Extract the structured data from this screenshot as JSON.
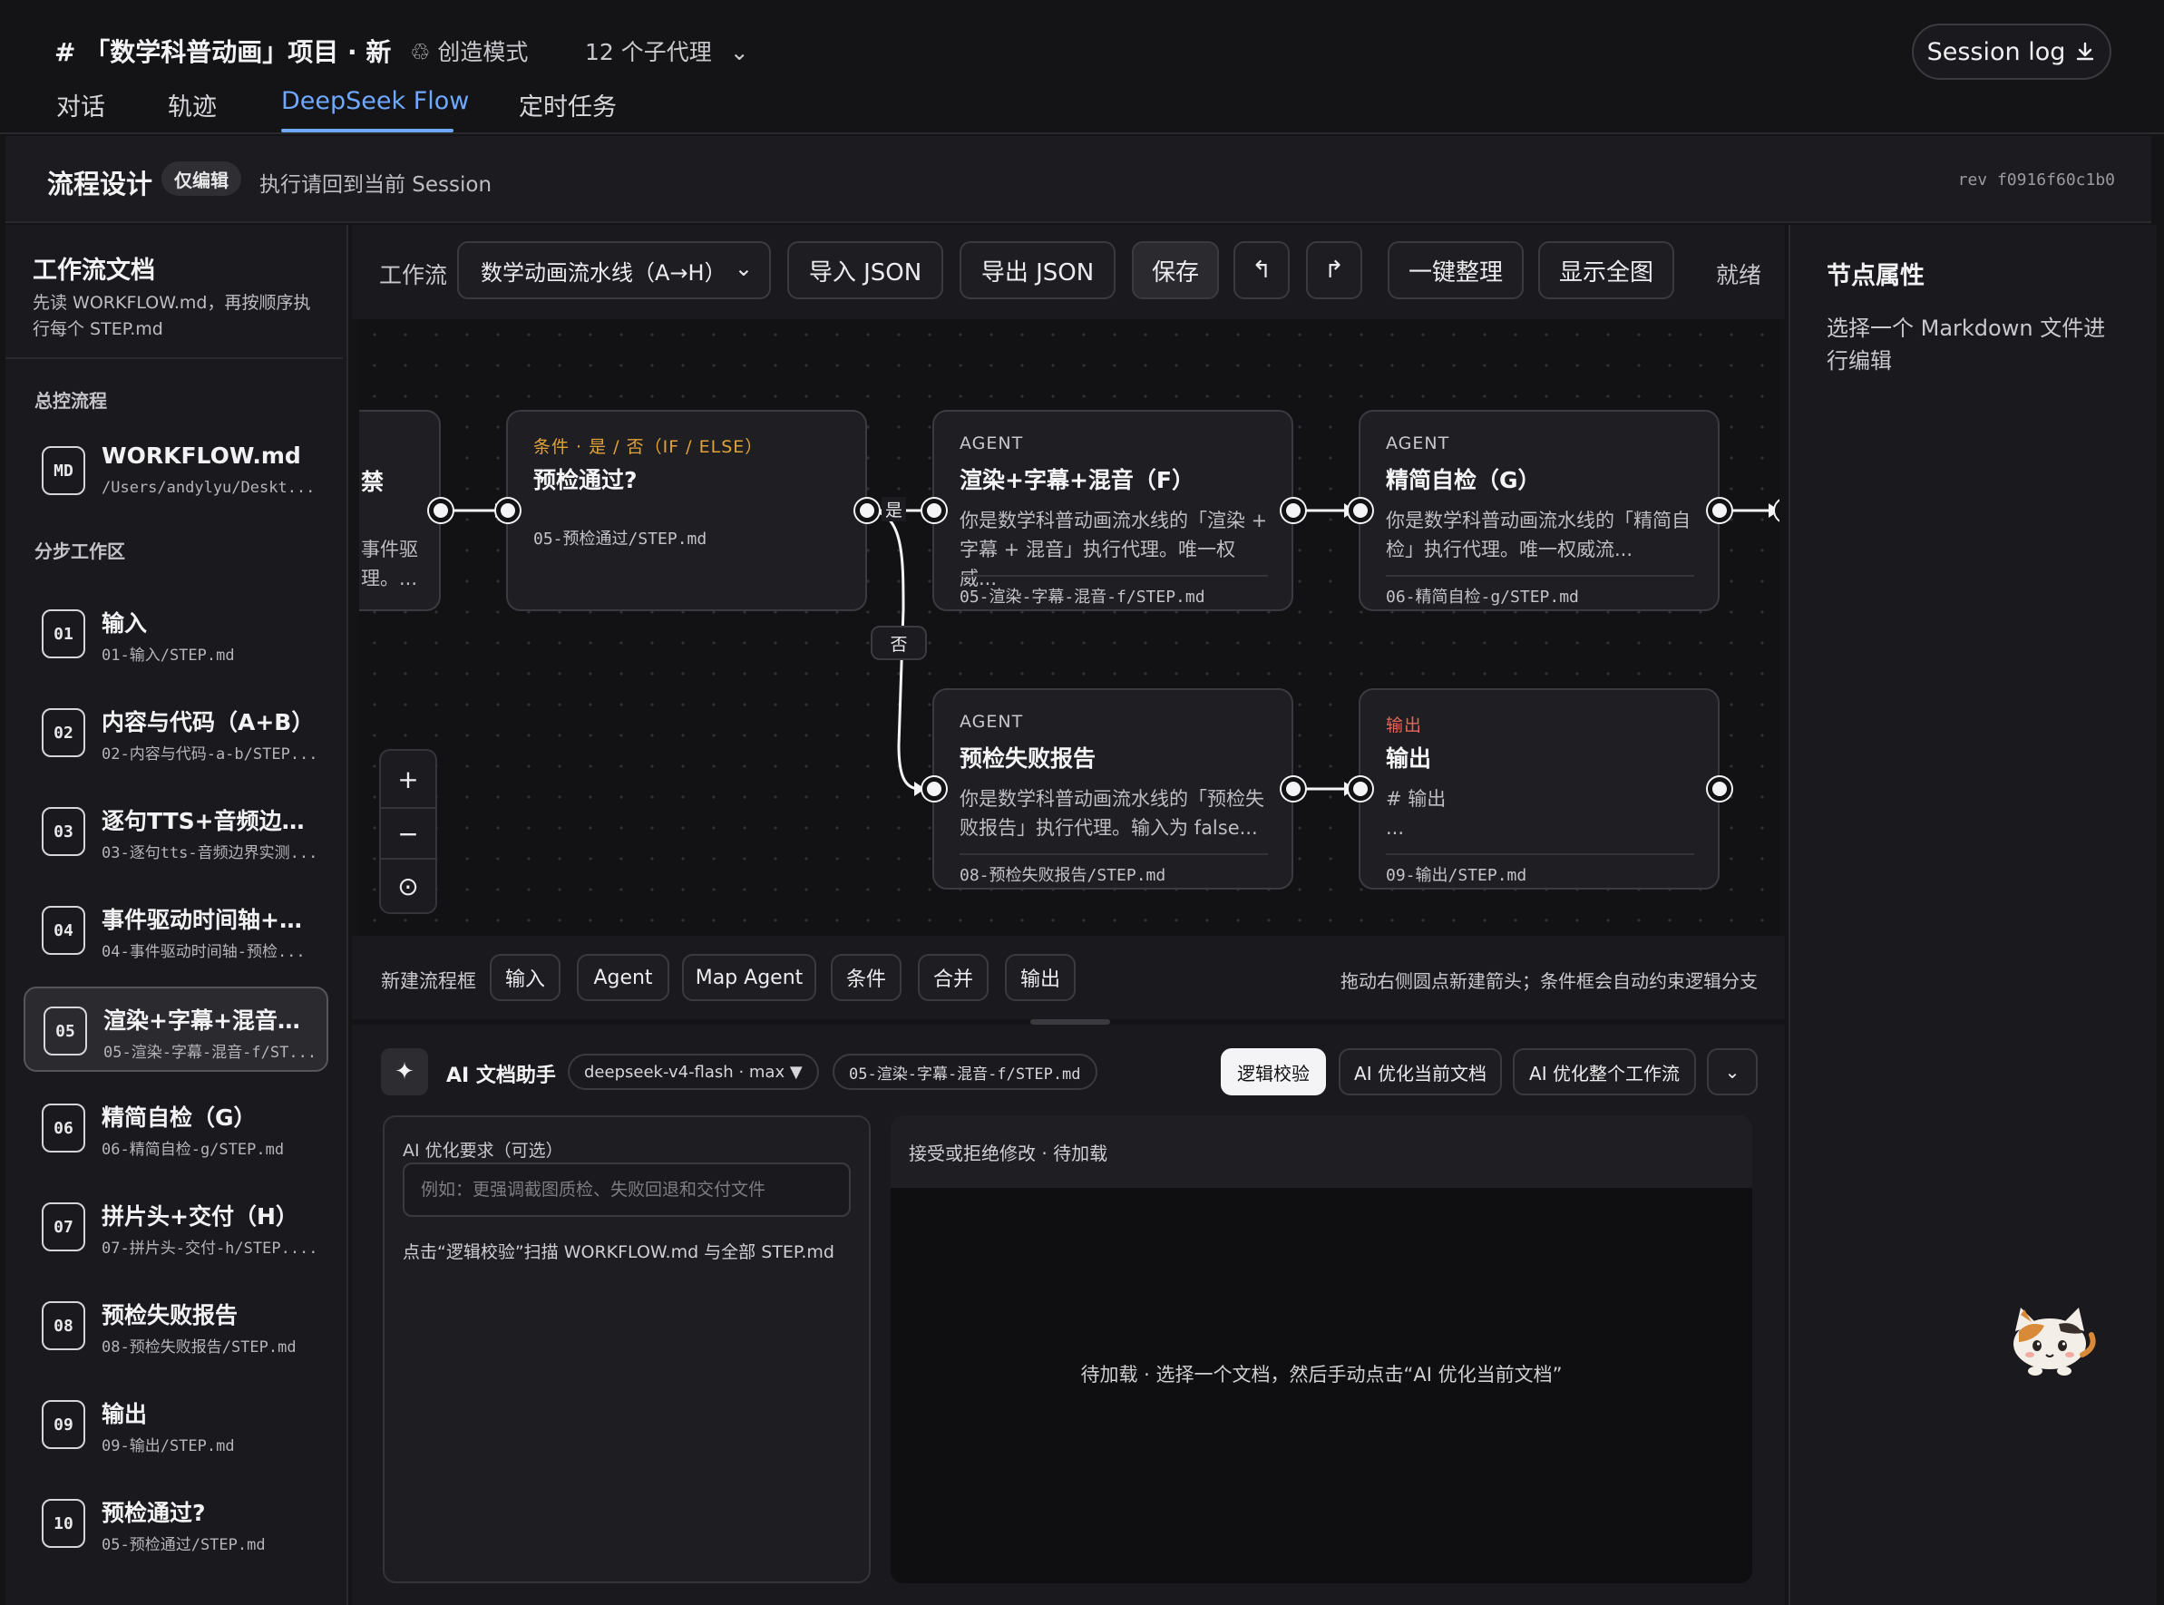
{
  "header": {
    "project_title": "# 「数学科普动画」项目 · 新",
    "mode": "创造模式",
    "agents": "12 个子代理",
    "tabs": [
      "对话",
      "轨迹",
      "DeepSeek Flow",
      "定时任务"
    ],
    "active_tab": 2,
    "session_log": "Session log"
  },
  "design_bar": {
    "title": "流程设计",
    "badge": "仅编辑",
    "note": "执行请回到当前 Session",
    "rev": "rev f0916f60c1b0"
  },
  "sidebar": {
    "title": "工作流文档",
    "description": "先读 WORKFLOW.md，再按顺序执行每个 STEP.md",
    "master_section": "总控流程",
    "master_item": {
      "badge": "MD",
      "name": "WORKFLOW.md",
      "path": "/Users/andylyu/Deskt..."
    },
    "steps_section": "分步工作区",
    "items": [
      {
        "badge": "01",
        "name": "输入",
        "path": "01-输入/STEP.md"
      },
      {
        "badge": "02",
        "name": "内容与代码（A+B）",
        "path": "02-内容与代码-a-b/STEP..."
      },
      {
        "badge": "03",
        "name": "逐句TTS+音频边界...",
        "path": "03-逐句tts-音频边界实测..."
      },
      {
        "badge": "04",
        "name": "事件驱动时间轴+预...",
        "path": "04-事件驱动时间轴-预检..."
      },
      {
        "badge": "05",
        "name": "渲染+字幕+混音（...",
        "path": "05-渲染-字幕-混音-f/ST..."
      },
      {
        "badge": "06",
        "name": "精简自检（G）",
        "path": "06-精简自检-g/STEP.md"
      },
      {
        "badge": "07",
        "name": "拼片头+交付（H）",
        "path": "07-拼片头-交付-h/STEP...."
      },
      {
        "badge": "08",
        "name": "预检失败报告",
        "path": "08-预检失败报告/STEP.md"
      },
      {
        "badge": "09",
        "name": "输出",
        "path": "09-输出/STEP.md"
      },
      {
        "badge": "10",
        "name": "预检通过?",
        "path": "05-预检通过/STEP.md"
      }
    ],
    "active_index": 4
  },
  "toolbar": {
    "workflow_label": "工作流",
    "workflow_value": "数学动画流水线（A→H）",
    "import": "导入 JSON",
    "export": "导出 JSON",
    "save": "保存",
    "undo": "↰",
    "redo": "↱",
    "tidy": "一键整理",
    "fit": "显示全图",
    "status": "就绪"
  },
  "canvas": {
    "partial_node": {
      "title_fragment": "禁",
      "desc": "事件驱理。..."
    },
    "nodes": [
      {
        "kind": "条件 · 是 / 否（IF / ELSE）",
        "title": "预检通过?",
        "desc": "",
        "file": "05-预检通过/STEP.md",
        "kind_color": "#e0a23a"
      },
      {
        "kind": "AGENT",
        "title": "渲染+字幕+混音（F）",
        "desc": "你是数学科普动画流水线的「渲染 + 字幕 + 混音」执行代理。唯一权威...",
        "file": "05-渲染-字幕-混音-f/STEP.md",
        "kind_color": "#c9c9cd"
      },
      {
        "kind": "AGENT",
        "title": "精简自检（G）",
        "desc": "你是数学科普动画流水线的「精简自检」执行代理。唯一权威流...",
        "file": "06-精简自检-g/STEP.md",
        "kind_color": "#c9c9cd"
      },
      {
        "kind": "AGENT",
        "title": "预检失败报告",
        "desc": "你是数学科普动画流水线的「预检失败报告」执行代理。输入为 false...",
        "file": "08-预检失败报告/STEP.md",
        "kind_color": "#c9c9cd"
      },
      {
        "kind": "输出",
        "title": "输出",
        "desc": "# 输出\n...",
        "file": "09-输出/STEP.md",
        "kind_color": "#e06a5a"
      }
    ],
    "yes_label": "是",
    "no_label": "否",
    "zoom_in": "+",
    "zoom_out": "−",
    "zoom_fit": "⊙"
  },
  "new_bar": {
    "label": "新建流程框",
    "buttons": [
      "输入",
      "Agent",
      "Map Agent",
      "条件",
      "合并",
      "输出"
    ],
    "hint": "拖动右侧圆点新建箭头；条件框会自动约束逻辑分支"
  },
  "ai": {
    "star": "✦",
    "title": "AI 文档助手",
    "model": "deepseek-v4-flash · max ▼",
    "file": "05-渲染-字幕-混音-f/STEP.md",
    "check": "逻辑校验",
    "optimize_doc": "AI 优化当前文档",
    "optimize_flow": "AI 优化整个工作流",
    "more": "⌄",
    "req_label": "AI 优化要求（可选）",
    "req_placeholder": "例如：更强调截图质检、失败回退和交付文件",
    "hint": "点击“逻辑校验”扫描 WORKFLOW.md 与全部 STEP.md",
    "right_head": "接受或拒绝修改 · 待加载",
    "right_body": "待加载 · 选择一个文档，然后手动点击“AI 优化当前文档”"
  },
  "right_panel": {
    "title": "节点属性",
    "desc": "选择一个 Markdown 文件进行编辑"
  }
}
